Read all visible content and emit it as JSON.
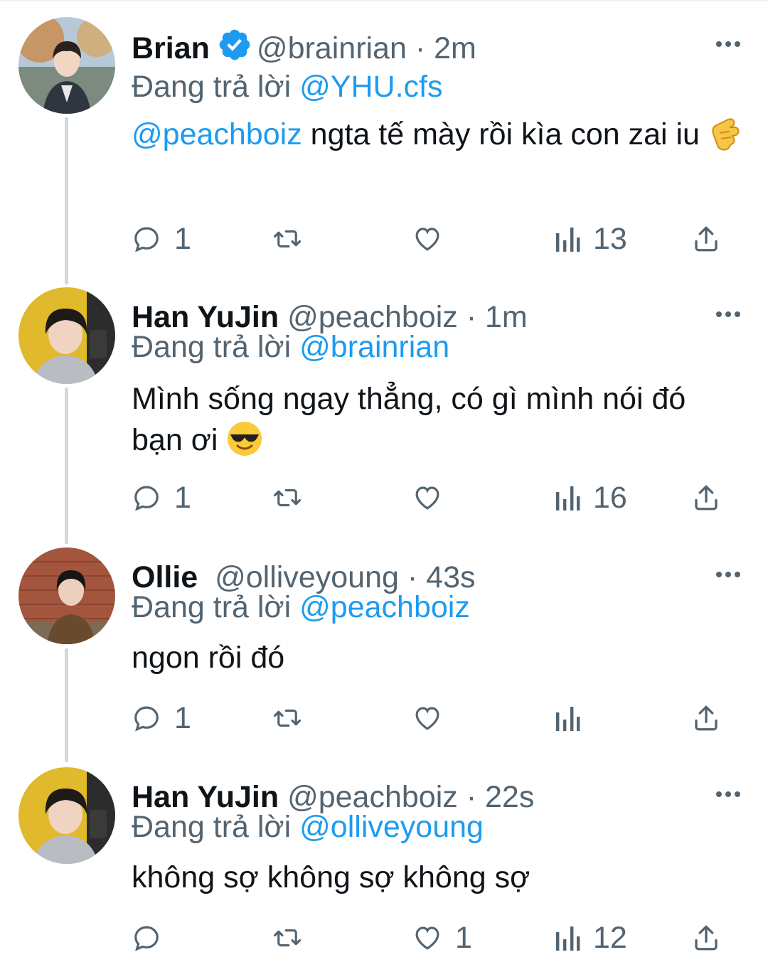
{
  "reply_prefix": "Đang trả lời",
  "tweets": [
    {
      "name": "Brian",
      "verified": true,
      "handle": "@brainrian",
      "separator": "·",
      "time": "2m",
      "reply_to": "@YHU.cfs",
      "mention": "@peachboiz",
      "text": " ngta tế mày rồi kìa con zai iu",
      "emoji": "call-me-hand",
      "replies": "1",
      "likes": "",
      "views": "13"
    },
    {
      "name": "Han YuJin",
      "verified": false,
      "handle": "@peachboiz",
      "separator": "·",
      "time": "1m",
      "reply_to": "@brainrian",
      "mention": "",
      "text": "Mình sống ngay thẳng, có gì mình nói đó bạn ơi",
      "emoji": "sunglasses-face",
      "replies": "1",
      "likes": "",
      "views": "16"
    },
    {
      "name": "Ollie",
      "verified": false,
      "handle": "@olliveyoung",
      "separator": "·",
      "time": "43s",
      "reply_to": "@peachboiz",
      "mention": "",
      "text": "ngon rồi đó",
      "emoji": "",
      "replies": "1",
      "likes": "",
      "views": ""
    },
    {
      "name": "Han YuJin",
      "verified": false,
      "handle": "@peachboiz",
      "separator": "·",
      "time": "22s",
      "reply_to": "@olliveyoung",
      "mention": "",
      "text": "không sợ không sợ không sợ",
      "emoji": "",
      "replies": "",
      "likes": "1",
      "views": "12"
    }
  ],
  "colors": {
    "link": "#1d9bf0",
    "secondary_text": "#536471",
    "thread_line": "#cfd9de",
    "verified": "#1d9bf0"
  }
}
